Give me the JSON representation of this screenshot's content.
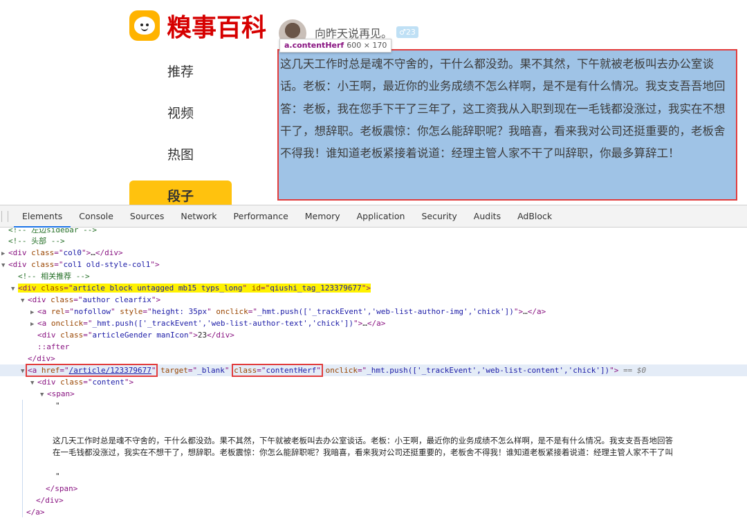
{
  "site": {
    "logo_text": "糗事百科",
    "nav": [
      {
        "label": "推荐"
      },
      {
        "label": "视频"
      },
      {
        "label": "热图"
      },
      {
        "label": "段子"
      }
    ],
    "active_nav": "段子"
  },
  "article": {
    "author_name": "向昨天说再见。",
    "gender_age": "♂23",
    "content": "这几天工作时总是魂不守舍的，干什么都没劲。果不其然，下午就被老板叫去办公室谈话。老板：小王啊，最近你的业务成绩不怎么样啊，是不是有什么情况。我支支吾吾地回答：老板，我在您手下干了三年了，这工资我从入职到现在一毛钱都没涨过，我实在不想干了，想辞职。老板震惊：你怎么能辞职呢？我暗喜，看来我对公司还挺重要的，老板舍不得我！谁知道老板紧接着说道：经理主管人家不干了叫辞职，你最多算辞工！"
  },
  "tooltip": {
    "selector": "a.contentHerf",
    "size": "600 × 170"
  },
  "devtools": {
    "tabs": [
      "Elements",
      "Console",
      "Sources",
      "Network",
      "Performance",
      "Memory",
      "Application",
      "Security",
      "Audits",
      "AdBlock"
    ],
    "active_tab": "Elements",
    "tree": {
      "c_sidebar": "<!-- 左边sidebar -->",
      "c_header": "<!-- 头部 -->",
      "col0_class": "col0",
      "col1_class": "col1 old-style-col1",
      "c_related": "<!-- 相关推荐 -->",
      "article_class": "article block untagged mb15 typs_long",
      "article_id": "qiushi_tag_123379677",
      "author_class": "author clearfix",
      "a1_rel": "nofollow",
      "a1_style": "height: 35px",
      "a1_onclick": "_hmt.push(['_trackEvent','web-list-author-img','chick'])",
      "a2_onclick": "_hmt.push(['_trackEvent','web-list-author-text','chick'])",
      "gender_class": "articleGender manIcon",
      "gender_text": "23",
      "after": "::after",
      "href": "/article/123379677",
      "target": "_blank",
      "a_class": "contentHerf",
      "a_onclick": "_hmt.push(['_trackEvent','web-list-content','chick'])",
      "eq_ref": "== $0",
      "content_class": "content",
      "text_line1": "这几天工作时总是魂不守舍的，干什么都没劲。果不其然，下午就被老板叫去办公室谈话。老板：小王啊，最近你的业务成绩不怎么样啊，是不是有什么情况。我支支吾吾地回答",
      "text_line2": "在一毛钱都没涨过，我实在不想干了，想辞职。老板震惊：你怎么能辞职呢？我暗喜，看来我对公司还挺重要的，老板舍不得我！谁知道老板紧接着说道：经理主管人家不干了叫"
    }
  },
  "colors": {
    "brand_yellow": "#ffc20e",
    "highlight_blue": "#9fc3e6",
    "annotation_red": "#e23c3c",
    "selected_yellow": "#fff200"
  }
}
